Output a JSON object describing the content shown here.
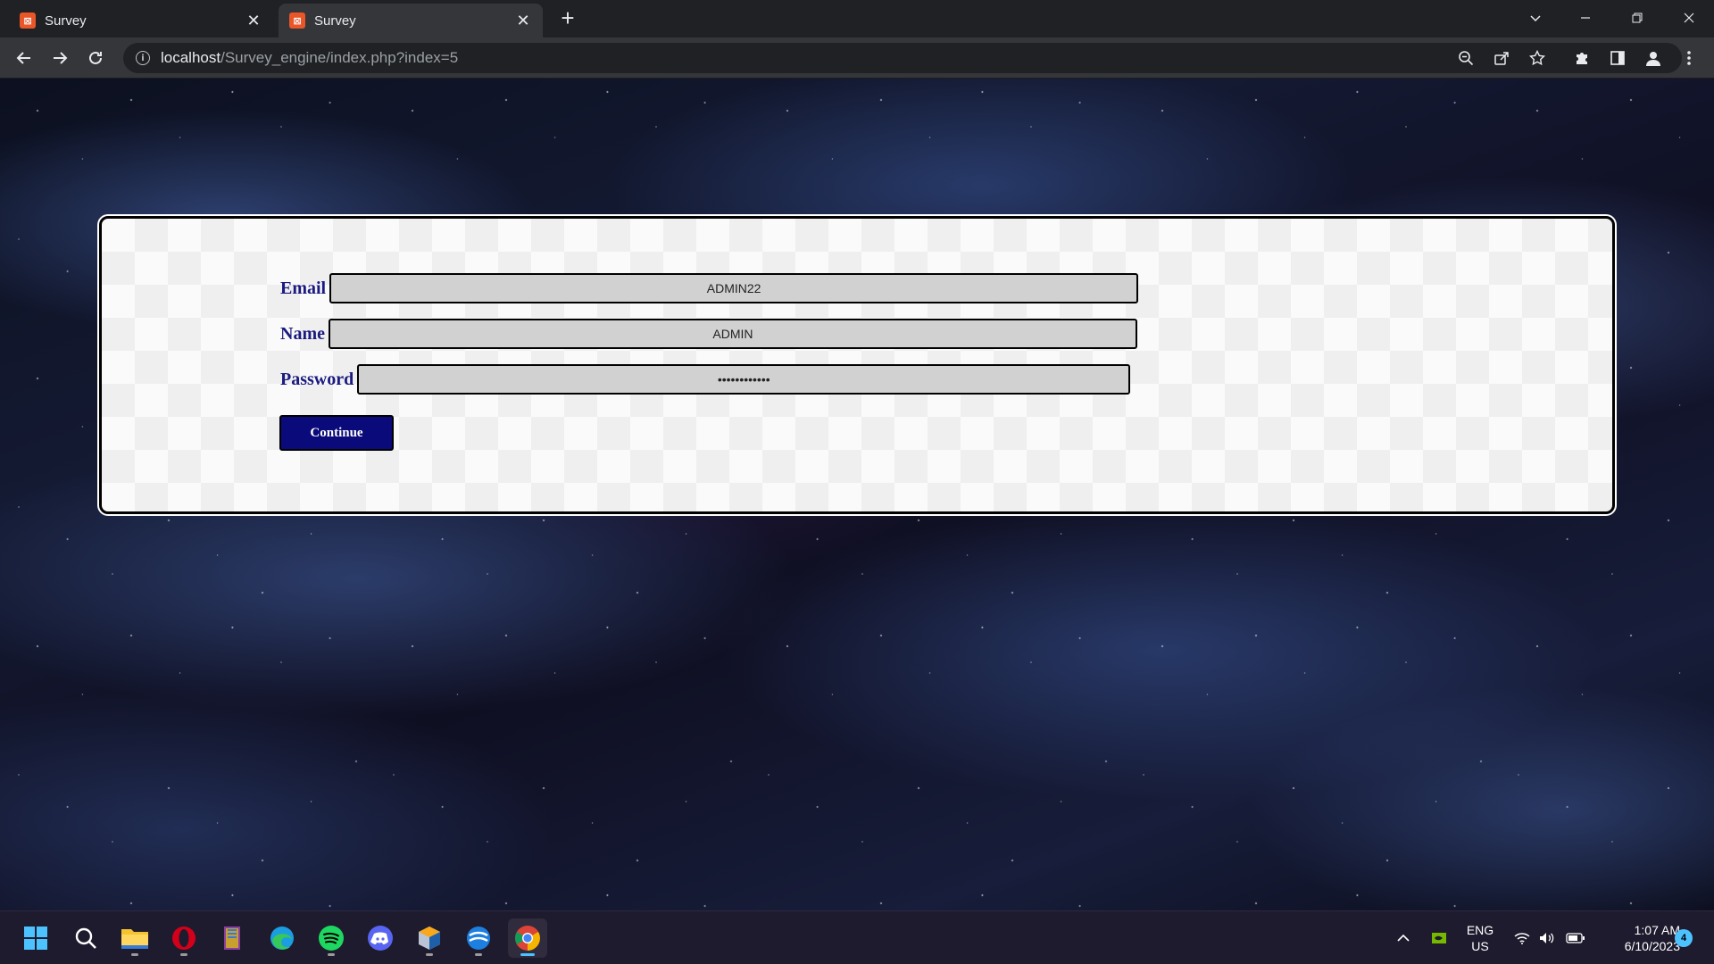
{
  "browser": {
    "tabs": [
      {
        "title": "Survey",
        "favicon": "xampp-icon"
      },
      {
        "title": "Survey",
        "favicon": "xampp-icon",
        "active": true
      }
    ],
    "url_host": "localhost",
    "url_path": "/Survey_engine/index.php?index=5"
  },
  "form": {
    "email_label": "Email",
    "email_value": "ADMIN22",
    "name_label": "Name",
    "name_value": "ADMIN",
    "password_label": "Password",
    "password_value": "••••••••••••",
    "continue_label": "Continue",
    "colors": {
      "label": "#1a1a80",
      "button_bg": "#0a0a7a",
      "field_bg": "#d1d1d1"
    }
  },
  "taskbar": {
    "apps": [
      "windows-start-icon",
      "search-icon",
      "file-explorer-icon",
      "opera-icon",
      "winrar-icon",
      "edge-icon",
      "spotify-icon",
      "discord-icon",
      "virtualbox-icon",
      "browser-app-icon",
      "chrome-icon"
    ],
    "lang_line1": "ENG",
    "lang_line2": "US",
    "time": "1:07 AM",
    "date": "6/10/2023",
    "notification_count": "4"
  }
}
